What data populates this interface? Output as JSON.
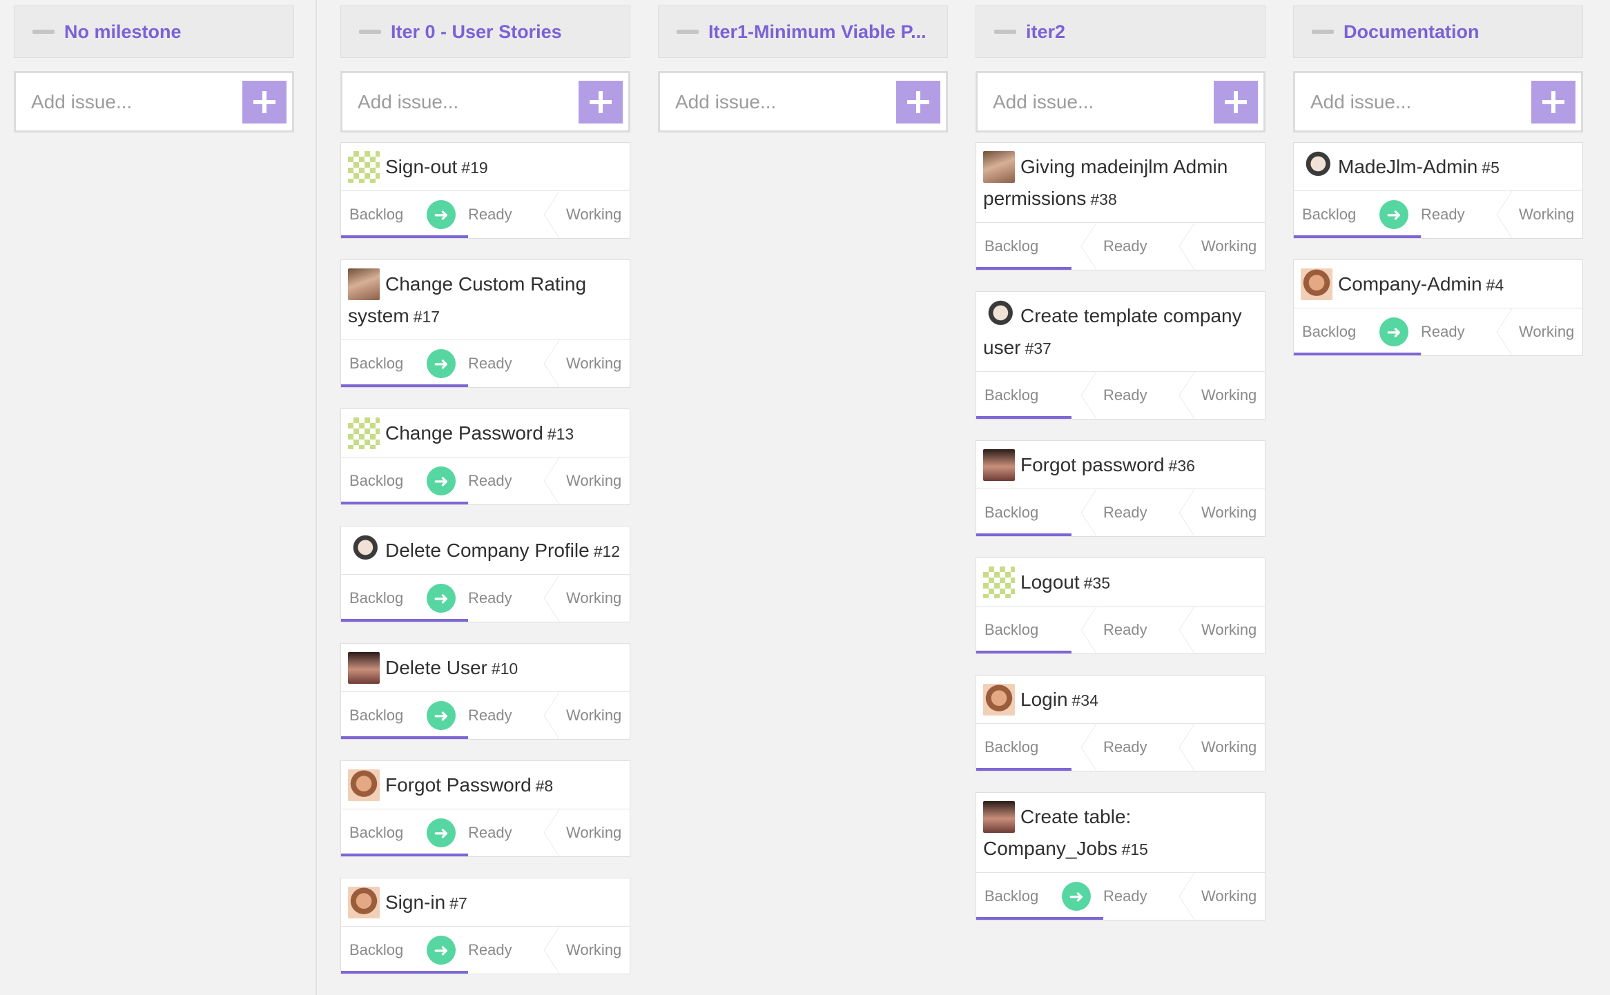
{
  "common": {
    "add_placeholder": "Add issue...",
    "lanes": {
      "backlog": "Backlog",
      "ready": "Ready",
      "working": "Working"
    }
  },
  "columns": [
    {
      "title": "No milestone",
      "issues": []
    },
    {
      "title": "Iter 0 - User Stories",
      "issues": [
        {
          "title": "Sign-out",
          "number": "#19",
          "avatar": "pixel",
          "progress": 0.44
        },
        {
          "title": "Change Custom Rating system",
          "number": "#17",
          "avatar": "photo-a",
          "progress": 0.44
        },
        {
          "title": "Change Password",
          "number": "#13",
          "avatar": "pixel",
          "progress": 0.44
        },
        {
          "title": "Delete Company Profile",
          "number": "#12",
          "avatar": "photo-b",
          "progress": 0.44
        },
        {
          "title": "Delete User",
          "number": "#10",
          "avatar": "photo-c",
          "progress": 0.44
        },
        {
          "title": "Forgot Password",
          "number": "#8",
          "avatar": "photo-d",
          "progress": 0.44
        },
        {
          "title": "Sign-in",
          "number": "#7",
          "avatar": "photo-d",
          "progress": 0.44
        }
      ]
    },
    {
      "title": "Iter1-Minimum Viable P...",
      "issues": []
    },
    {
      "title": "iter2",
      "issues": [
        {
          "title": "Giving madeinjlm Admin permissions",
          "number": "#38",
          "avatar": "photo-a",
          "progress": 0.33
        },
        {
          "title": "Create template company user",
          "number": "#37",
          "avatar": "photo-b",
          "progress": 0.33
        },
        {
          "title": "Forgot password",
          "number": "#36",
          "avatar": "photo-c",
          "progress": 0.33
        },
        {
          "title": "Logout",
          "number": "#35",
          "avatar": "pixel",
          "progress": 0.33
        },
        {
          "title": "Login",
          "number": "#34",
          "avatar": "photo-d",
          "progress": 0.33
        },
        {
          "title": "Create table: Company_Jobs",
          "number": "#15",
          "avatar": "photo-c",
          "progress": 0.44
        }
      ]
    },
    {
      "title": "Documentation",
      "issues": [
        {
          "title": "MadeJlm-Admin",
          "number": "#5",
          "avatar": "photo-b",
          "progress": 0.44
        },
        {
          "title": "Company-Admin",
          "number": "#4",
          "avatar": "photo-d",
          "progress": 0.44
        }
      ]
    }
  ],
  "icons": {
    "collapse": "collapse-icon",
    "add": "plus-icon",
    "move": "arrow-right-circle-icon"
  },
  "colors": {
    "accent": "#7a62d6",
    "add_button": "#b39ee6",
    "move_button": "#56d6a0"
  }
}
